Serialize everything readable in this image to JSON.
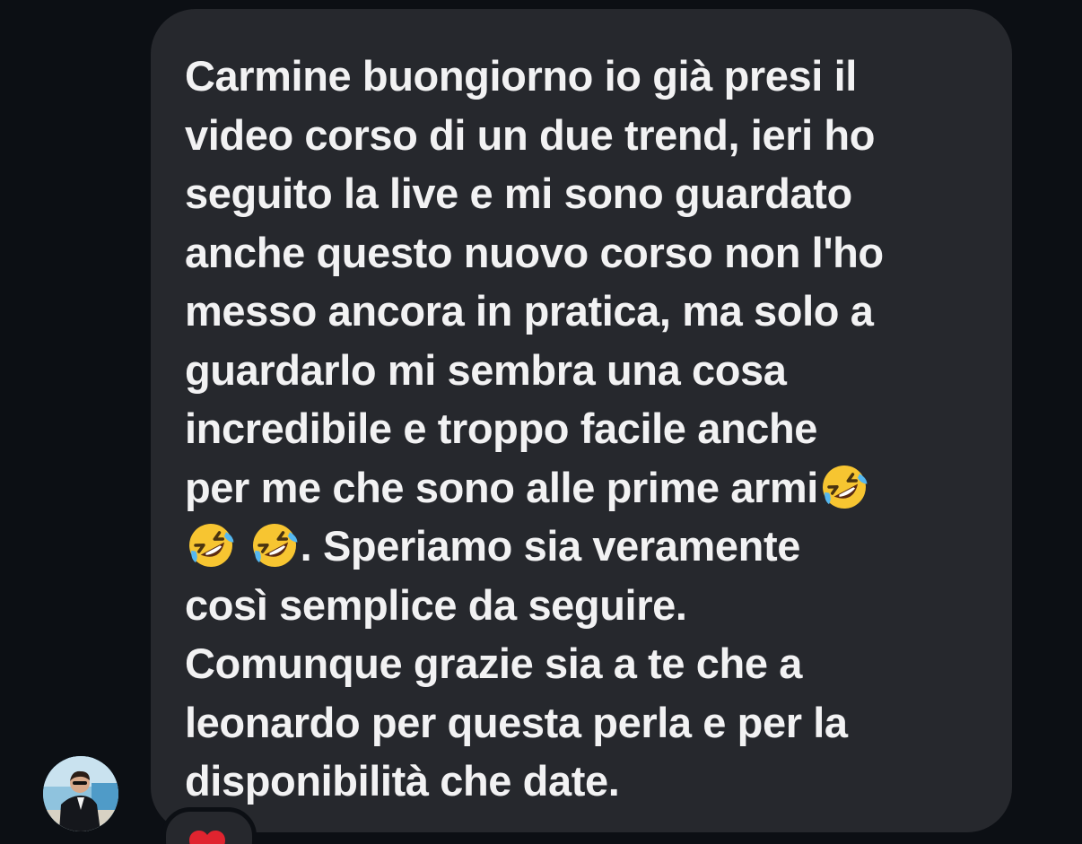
{
  "message": {
    "lines": [
      "Carmine buongiorno io già presi il",
      "video corso di un due trend, ieri ho",
      "seguito la live e mi sono guardato",
      "anche questo nuovo corso non l'ho",
      "messo ancora in pratica, ma solo a",
      "guardarlo mi sembra una cosa",
      "incredibile e troppo facile anche",
      "per me che sono alle prime armi",
      ". Speriamo sia veramente",
      "così semplice da seguire.",
      "Comunque grazie sia a te che a",
      "leonardo per questa perla e per la",
      "disponibilità che date."
    ],
    "emojis": [
      "rolling-on-floor-laughing",
      "rolling-on-floor-laughing",
      "rolling-on-floor-laughing"
    ]
  },
  "sender": {
    "avatar_icon": "profile-photo"
  },
  "reaction": {
    "icon": "heart-icon",
    "color": "#e0242f"
  },
  "colors": {
    "background": "#0c0f14",
    "bubble": "#26282d",
    "text": "#f2f2f3"
  }
}
